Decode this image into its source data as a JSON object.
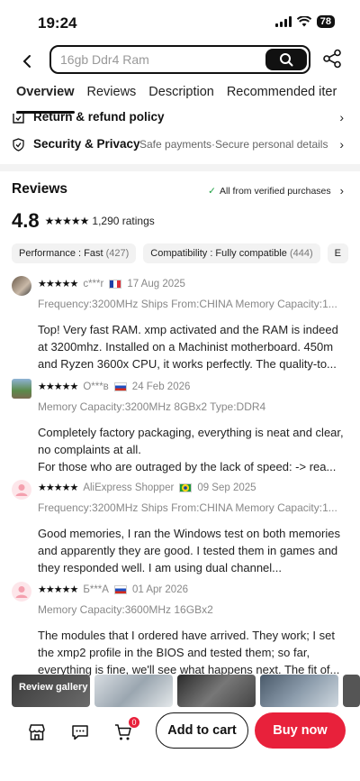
{
  "status": {
    "time": "19:24",
    "battery": "78"
  },
  "search": {
    "value": "16gb Ddr4 Ram"
  },
  "tabs": [
    "Overview",
    "Reviews",
    "Description",
    "Recommended iter"
  ],
  "policies": [
    {
      "title": "Return & refund policy",
      "subtitle": ""
    },
    {
      "title": "Security & Privacy",
      "subtitle": "Safe payments·Secure personal details"
    }
  ],
  "reviews_section": {
    "title": "Reviews",
    "verified": "All from verified purchases",
    "rating": "4.8",
    "rating_stars": 4.8,
    "ratings_count": "1,290 ratings",
    "chips": [
      {
        "label": "Performance : Fast",
        "count": "(427)"
      },
      {
        "label": "Compatibility : Fully compatible",
        "count": "(444)"
      },
      {
        "label": "E",
        "count": ""
      }
    ]
  },
  "reviews": [
    {
      "name": "c***r",
      "date": "17 Aug 2025",
      "spec": "Frequency:3200MHz Ships From:CHINA Memory Capacity:1...",
      "body": "Top! Very fast RAM. xmp activated and the RAM is indeed at 3200mhz. Installed on a Machinist motherboard. 450m and Ryzen 3600x CPU, it works perfectly. The quality-to..."
    },
    {
      "name": "O***в",
      "date": "24 Feb 2026",
      "spec": "Memory Capacity:3200MHz 8GBx2 Type:DDR4",
      "body": "Completely factory packaging, everything is neat and clear, no complaints at all.\n For those who are outraged by the lack of speed: -> rea..."
    },
    {
      "name": "AliExpress Shopper",
      "date": "09 Sep 2025",
      "spec": "Frequency:3200MHz Ships From:CHINA Memory Capacity:1...",
      "body": "Good memories, I ran the Windows test on both memories and apparently they are good. I tested them in games and they responded well. I am using dual channel..."
    },
    {
      "name": "Б***А",
      "date": "01 Apr 2026",
      "spec": "Memory Capacity:3600MHz 16GBx2",
      "body": "The modules that I ordered have arrived. They work; I set the xmp2 profile in the BIOS and tested them; so far, everything is fine, we'll see what happens next. The fit of..."
    }
  ],
  "gallery": {
    "label": "Review gallery"
  },
  "bottom": {
    "cart_count": "0",
    "add_to_cart": "Add to cart",
    "buy_now": "Buy now"
  }
}
